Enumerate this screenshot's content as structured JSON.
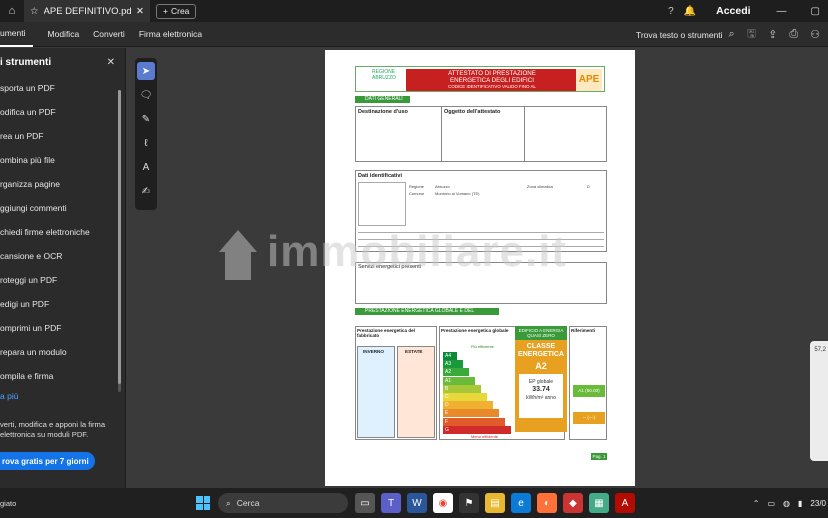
{
  "window": {
    "tab_title": "APE DEFINITIVO.pdf",
    "new_tab_label": "Crea",
    "signin_label": "Accedi"
  },
  "menu": {
    "items": [
      "umenti",
      "Modifica",
      "Converti",
      "Firma elettronica"
    ],
    "find_label": "Trova testo o strumenti"
  },
  "sidebar": {
    "title": "i strumenti",
    "tools": [
      "sporta un PDF",
      "odifica un PDF",
      "rea un PDF",
      "ombina più file",
      "rganizza pagine",
      "ggiungi commenti",
      "chiedi firme elettroniche",
      "cansione e OCR",
      "roteggi un PDF",
      "edigi un PDF",
      "omprimi un PDF",
      "repara un modulo",
      "ompila e firma"
    ],
    "more_label": "a più",
    "promo_text": "verti, modifica e apponi la firma elettronica su moduli PDF.",
    "trial_button": "rova gratis per 7 giorni"
  },
  "right_panel": {
    "value": "57,2"
  },
  "watermark": {
    "text": "immobiliare.it"
  },
  "document": {
    "region": "REGIONE ABRUZZO",
    "title_line1": "ATTESTATO DI PRESTAZIONE",
    "title_line2": "ENERGETICA DEGLI EDIFICI",
    "title_line3": "CODICE IDENTIFICATIVO        VALIDO FINO AL",
    "ape_badge": "APE",
    "sec_dati_generali": "DATI GENERALI",
    "destinazione": "Destinazione d'uso",
    "oggetto": "Oggetto dell'attestato",
    "dati_identificativi": "Dati identificativi",
    "regione_label": "Regione",
    "regione_value": "Abruzzo",
    "comune_label": "Comune",
    "comune_value": "Montorio al Vomano (TE)",
    "zona_label": "Zona climatica",
    "zona_value": "D",
    "servizi": "Servizi energetici presenti",
    "sec_prestazione": "PRESTAZIONE ENERGETICA GLOBALE E DEL FABBRICATO",
    "prest_fabbricato": "Prestazione energetica del fabbricato",
    "prest_globale": "Prestazione energetica globale",
    "riferimenti": "Riferimenti",
    "inverno": "INVERNO",
    "estate": "ESTATE",
    "piu_efficiente": "Più efficiente",
    "meno_efficiente": "Meno efficiente",
    "classe_header": "EDIFICIO A ENERGIA QUASI ZERO",
    "classe_label": "CLASSE ENERGETICA",
    "classe_value": "A2",
    "ep_label": "EP globale",
    "ep_value": "33.74",
    "ep_unit": "kWh/m² anno",
    "ref_value": "A1 (50.00)",
    "ref_blank": "-- (---)",
    "page_tag": "Pag. 1"
  },
  "energy_classes": [
    "A4",
    "A3",
    "A2",
    "A1",
    "B",
    "C",
    "D",
    "E",
    "F",
    "G"
  ],
  "energy_colors": [
    "#0a8a3a",
    "#1a9a3a",
    "#3aaa3a",
    "#6abb3a",
    "#a8c83a",
    "#e8d83a",
    "#f0b030",
    "#e88a2a",
    "#e05a2a",
    "#d02a2a"
  ],
  "taskbar": {
    "left_label": "giato",
    "search_label": "Cerca",
    "date": "23/0"
  }
}
